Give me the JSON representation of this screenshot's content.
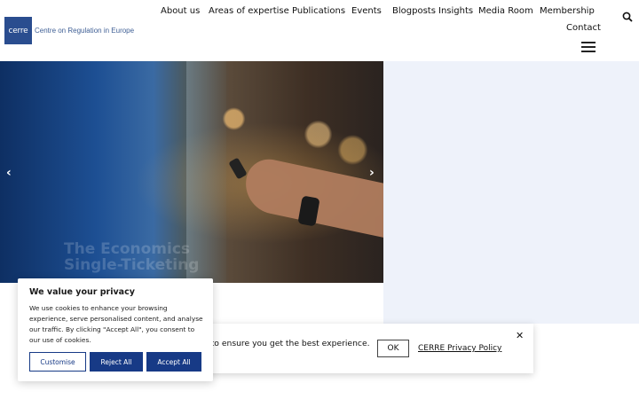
{
  "brand": {
    "logo_text": "cerre",
    "name": "Centre on Regulation in Europe",
    "color": "#2a4d8f"
  },
  "nav": {
    "items": [
      "About us",
      "Areas of expertise",
      "Publications",
      "Events",
      "Blogposts",
      "Insights",
      "Media Room",
      "Membership",
      "Contact"
    ],
    "search_icon": "search-icon",
    "menu_icon": "hamburger-menu-icon"
  },
  "hero": {
    "caption_line1": "The Economics",
    "caption_line2": "Single-Ticketing",
    "prev_arrow": "‹",
    "next_arrow": "›"
  },
  "notice_bar": {
    "text": "s to ensure you get the best experience.",
    "ok_label": "OK",
    "policy_link": "CERRE Privacy Policy",
    "close_label": "✕"
  },
  "cookie_banner": {
    "title": "We value your privacy",
    "body": "We use cookies to enhance your browsing experience, serve personalised content, and analyse our traffic. By clicking \"Accept All\", you consent to our use of cookies.",
    "customise_label": "Customise",
    "reject_label": "Reject All",
    "accept_label": "Accept All",
    "accent_color": "#173a86"
  }
}
